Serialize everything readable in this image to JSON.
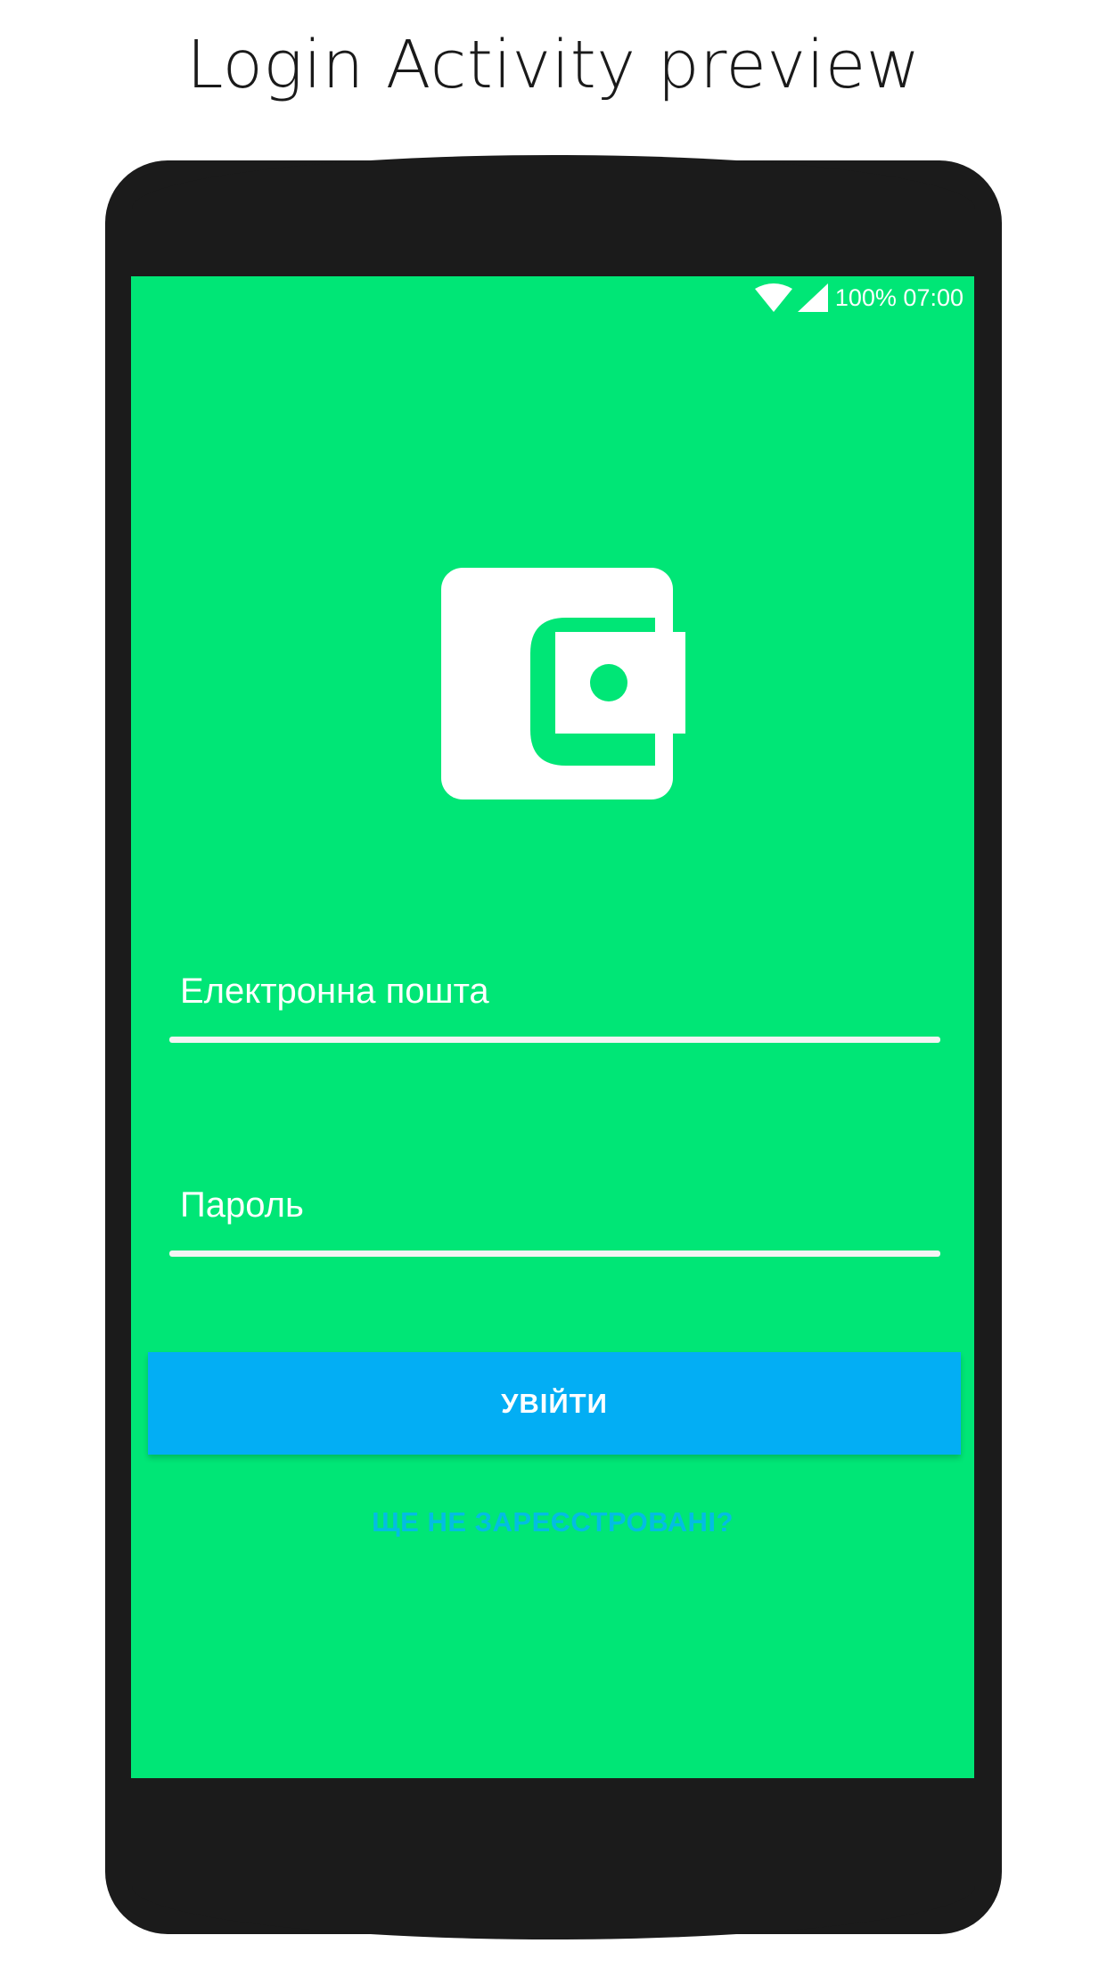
{
  "page": {
    "title": "Login Activity preview"
  },
  "status_bar": {
    "wifi_icon": "wifi-icon",
    "signal_icon": "cellular-signal-icon",
    "text": "100% 07:00"
  },
  "logo": {
    "icon": "wallet-icon"
  },
  "form": {
    "email_placeholder": "Електронна пошта",
    "password_placeholder": "Пароль",
    "login_label": "УВІЙТИ",
    "register_label": "ЩЕ НЕ ЗАРЕЄСТРОВАНІ?"
  },
  "colors": {
    "screen_background": "#00e676",
    "button": "#03aef4",
    "link": "#03bde2",
    "phone_body": "#1b1b1b"
  }
}
